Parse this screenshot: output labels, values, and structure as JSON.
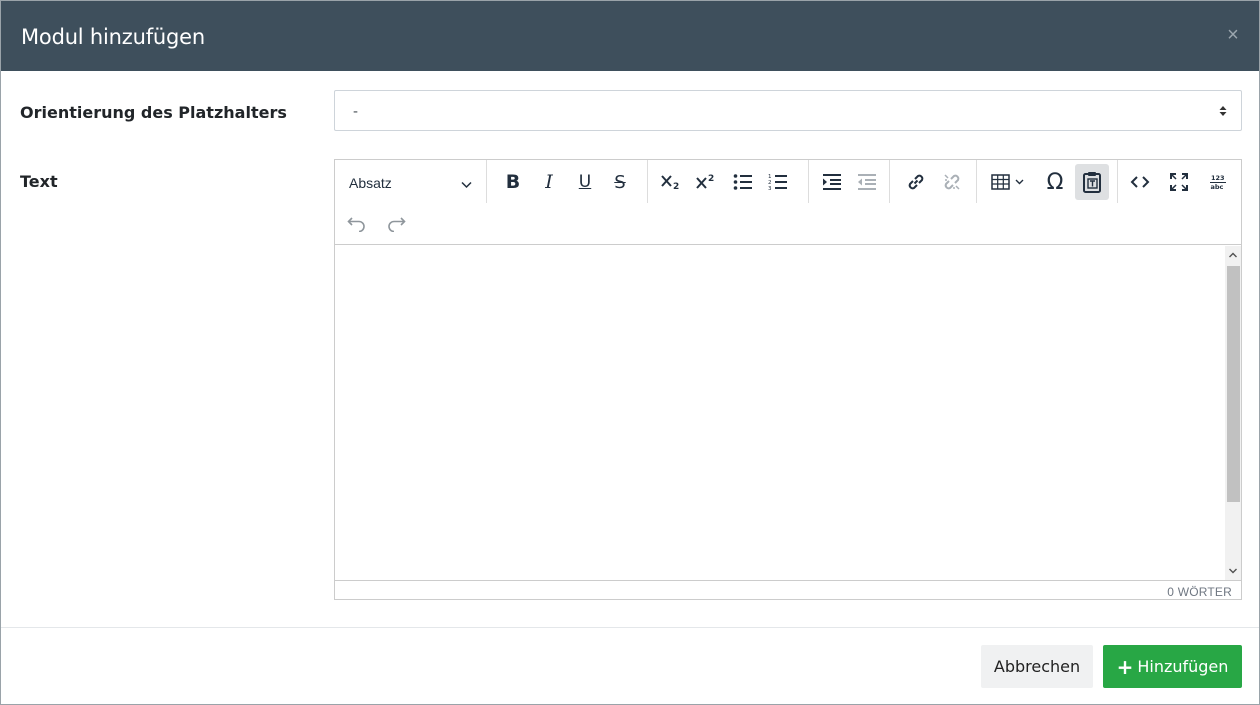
{
  "modal": {
    "title": "Modul hinzufügen",
    "close_icon": "close-icon",
    "close_glyph": "×"
  },
  "form": {
    "orientation_label": "Orientierung des Platzhalters",
    "orientation_value": "-",
    "text_label": "Text"
  },
  "editor": {
    "format_label": "Absatz",
    "toolbar_icons": [
      "bold-icon",
      "italic-icon",
      "underline-icon",
      "strikethrough-icon",
      "subscript-icon",
      "superscript-icon",
      "bullet-list-icon",
      "numbered-list-icon",
      "indent-icon",
      "outdent-icon",
      "link-icon",
      "unlink-icon",
      "table-icon",
      "special-char-icon",
      "paste-text-icon",
      "source-code-icon",
      "fullscreen-icon",
      "spellcheck-icon",
      "undo-icon",
      "redo-icon"
    ],
    "bold_glyph": "B",
    "italic_glyph": "I",
    "underline_glyph": "U",
    "strike_glyph": "S",
    "omega_glyph": "Ω",
    "word_count": "0 WÖRTER"
  },
  "footer": {
    "cancel_label": "Abbrechen",
    "add_plus": "+",
    "add_label": "Hinzufügen"
  },
  "colors": {
    "header_bg": "#3e4f5c",
    "primary_green": "#28a745"
  }
}
